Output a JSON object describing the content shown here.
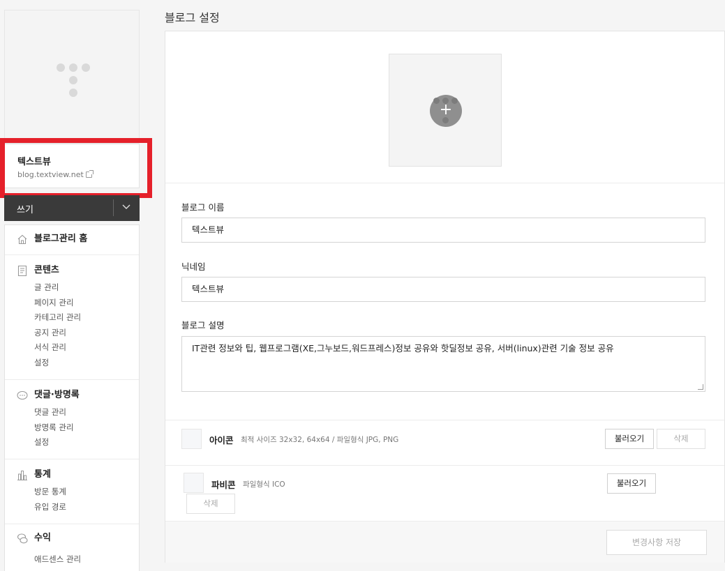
{
  "page_title": "블로그 설정",
  "sidebar": {
    "blog_name": "텍스트뷰",
    "blog_url": "blog.textview.net",
    "write_label": "쓰기",
    "sections": [
      {
        "title": "블로그관리 홈",
        "icon": "home-icon",
        "items": []
      },
      {
        "title": "콘텐츠",
        "icon": "document-icon",
        "items": [
          "글 관리",
          "페이지 관리",
          "카테고리 관리",
          "공지 관리",
          "서식 관리",
          "설정"
        ]
      },
      {
        "title": "댓글·방명록",
        "icon": "comment-icon",
        "items": [
          "댓글 관리",
          "방명록 관리",
          "설정"
        ]
      },
      {
        "title": "통계",
        "icon": "bar-chart-icon",
        "items": [
          "방문 통계",
          "유입 경로"
        ]
      },
      {
        "title": "수익",
        "icon": "coin-icon",
        "items": [
          "애드센스 관리"
        ]
      }
    ]
  },
  "form": {
    "blog_name_label": "블로그 이름",
    "blog_name_value": "텍스트뷰",
    "nickname_label": "닉네임",
    "nickname_value": "텍스트뷰",
    "description_label": "블로그 설명",
    "description_value": "IT관련 정보와 팁, 웹프로그램(XE,그누보드,워드프레스)정보 공유와 핫딜정보 공유, 서버(linux)관련 기술 정보 공유"
  },
  "icon_row": {
    "name": "아이콘",
    "desc": "최적 사이즈 32x32, 64x64 / 파일형식 JPG, PNG",
    "load_label": "불러오기",
    "delete_label": "삭제"
  },
  "favicon_row": {
    "name": "파비콘",
    "desc": "파일형식 ICO",
    "load_label": "불러오기",
    "delete_label": "삭제"
  },
  "upload": {
    "plus": "+"
  },
  "save_label": "변경사항 저장"
}
